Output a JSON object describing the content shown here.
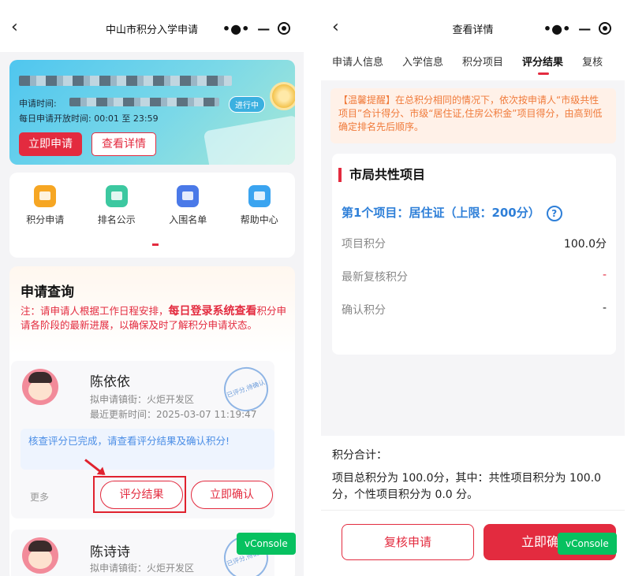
{
  "left": {
    "title": "中山市积分入学申请",
    "banner": {
      "apply_time_label": "申请时间:",
      "daily_open_time": "每日申请开放时间:  00:01 至 23:59",
      "status_tag": "进行中",
      "apply_button": "立即申请",
      "detail_button": "查看详情"
    },
    "menu": [
      {
        "label": "积分申请",
        "icon": "points-apply-icon",
        "color": "#f6a623"
      },
      {
        "label": "排名公示",
        "icon": "ranking-icon",
        "color": "#3cc8a0"
      },
      {
        "label": "入围名单",
        "icon": "shortlist-icon",
        "color": "#4a79e8"
      },
      {
        "label": "帮助中心",
        "icon": "help-center-icon",
        "color": "#3aa4f0"
      }
    ],
    "query": {
      "title": "申请查询",
      "note_prefix": "注：请申请人根据工作日程安排，",
      "note_emphasis": "每日登录系统查看",
      "note_suffix": "积分申请各阶段的最新进展，以确保及时了解积分申请状态。"
    },
    "applicants": [
      {
        "name": "陈依依",
        "street": "拟申请镇街：火炬开发区",
        "updated": "最近更新时间：2025-03-07 11:19:47",
        "stamp": "已评分,待确认"
      },
      {
        "name": "陈诗诗",
        "street": "拟申请镇街：火炬开发区",
        "stamp": "已评分,待确认"
      }
    ],
    "hint": "核查评分已完成，请查看评分结果及确认积分!",
    "more": "更多",
    "score_result_button": "评分结果",
    "confirm_button": "立即确认",
    "vconsole": "vConsole"
  },
  "right": {
    "title": "查看详情",
    "tabs": [
      "申请人信息",
      "入学信息",
      "积分项目",
      "评分结果",
      "复核"
    ],
    "active_tab": "评分结果",
    "warning": "【温馨提醒】在总积分相同的情况下，依次按申请人“市级共性项目”合计得分、市级“居住证,住房公积金”项目得分，由高到低确定排名先后顺序。",
    "section_title": "市局共性项目",
    "project_title": "第1个项目：居住证（上限：200分）",
    "rows": [
      {
        "label": "项目积分",
        "value": "100.0分"
      },
      {
        "label": "最新复核积分",
        "value": "-"
      },
      {
        "label": "确认积分",
        "value": "-"
      }
    ],
    "total_label": "积分合计：",
    "total_text": "项目总积分为 100.0分，其中：共性项目积分为 100.0 分，个性项目积分为 0.0 分。",
    "review_button": "复核申请",
    "confirm_button": "立即确",
    "vconsole": "vConsole"
  }
}
